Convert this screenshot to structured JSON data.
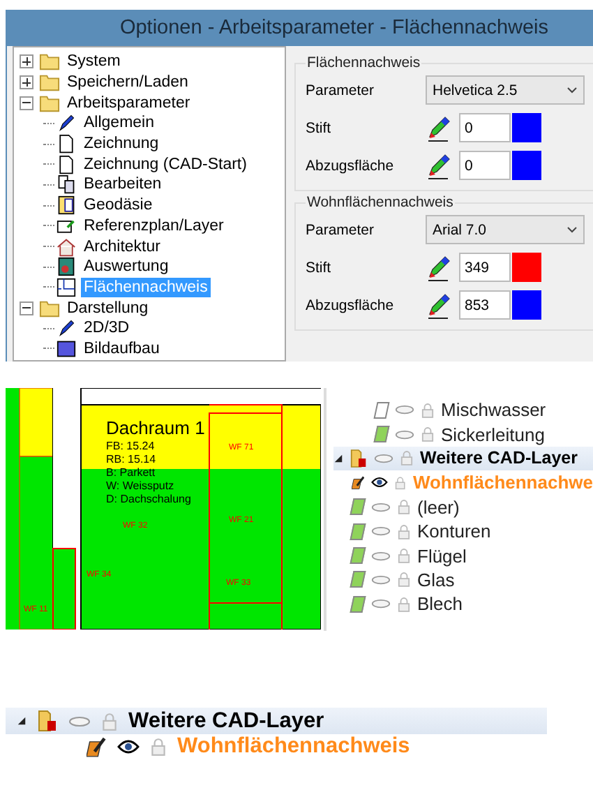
{
  "window": {
    "title": "Optionen - Arbeitsparameter - Flächennachweis"
  },
  "tree": [
    {
      "label": "System",
      "expanded": false,
      "selected": false
    },
    {
      "label": "Speichern/Laden",
      "expanded": false,
      "selected": false
    },
    {
      "label": "Arbeitsparameter",
      "expanded": true,
      "selected": false,
      "children": [
        {
          "label": "Allgemein",
          "selected": false
        },
        {
          "label": "Zeichnung",
          "selected": false
        },
        {
          "label": "Zeichnung (CAD-Start)",
          "selected": false
        },
        {
          "label": "Bearbeiten",
          "selected": false
        },
        {
          "label": "Geodäsie",
          "selected": false
        },
        {
          "label": "Referenzplan/Layer",
          "selected": false
        },
        {
          "label": "Architektur",
          "selected": false
        },
        {
          "label": "Auswertung",
          "selected": false
        },
        {
          "label": "Flächennachweis",
          "selected": true
        }
      ]
    },
    {
      "label": "Darstellung",
      "expanded": true,
      "selected": false,
      "children": [
        {
          "label": "2D/3D",
          "selected": false
        },
        {
          "label": "Bildaufbau",
          "selected": false
        }
      ]
    }
  ],
  "groups": [
    {
      "title": "Flächennachweis",
      "parameter_label": "Parameter",
      "parameter_value": "Helvetica 2.5",
      "pens": [
        {
          "label": "Stift",
          "value": "0",
          "color": "#0000ff"
        },
        {
          "label": "Abzugsfläche",
          "value": "0",
          "color": "#0000ff"
        }
      ]
    },
    {
      "title": "Wohnflächennachweis",
      "parameter_label": "Parameter",
      "parameter_value": "Arial 7.0",
      "pens": [
        {
          "label": "Stift",
          "value": "349",
          "color": "#ff0000"
        },
        {
          "label": "Abzugsfläche",
          "value": "853",
          "color": "#0000ff"
        }
      ]
    }
  ],
  "plan": {
    "room_name": "Dachraum 1",
    "room_lines": [
      "FB: 15.24",
      "RB: 15.14",
      "B: Parkett",
      "W: Weissputz",
      "D: Dachschalung"
    ],
    "labels": [
      "WF 71",
      "WF 21",
      "WF 32",
      "WF 34",
      "WF 33",
      "WF 11"
    ]
  },
  "layers": [
    {
      "kind": "layer",
      "name": "Mischwasser",
      "color": "#ffffff",
      "visible": false,
      "active": false
    },
    {
      "kind": "layer",
      "name": "Sickerleitung",
      "color": "#8fd35a",
      "visible": false,
      "active": false
    },
    {
      "kind": "group",
      "name": "Weitere CAD-Layer",
      "expanded": true,
      "children": [
        {
          "kind": "layer",
          "name": "Wohnflächennachwe",
          "visible": true,
          "active": true
        },
        {
          "kind": "layer",
          "name": "(leer)",
          "color": "#8fd35a",
          "visible": false,
          "active": false
        },
        {
          "kind": "layer",
          "name": "Konturen",
          "color": "#8fd35a",
          "visible": false,
          "active": false
        },
        {
          "kind": "layer",
          "name": "Flügel",
          "color": "#8fd35a",
          "visible": false,
          "active": false
        },
        {
          "kind": "layer",
          "name": "Glas",
          "color": "#8fd35a",
          "visible": false,
          "active": false
        },
        {
          "kind": "layer",
          "name": "Blech",
          "color": "#8fd35a",
          "visible": false,
          "active": false
        }
      ]
    }
  ],
  "detail": [
    {
      "kind": "group",
      "name": "Weitere CAD-Layer",
      "expanded": true,
      "children": [
        {
          "kind": "layer",
          "name": "Wohnflächennachweis",
          "visible": true,
          "active": true
        }
      ]
    }
  ]
}
